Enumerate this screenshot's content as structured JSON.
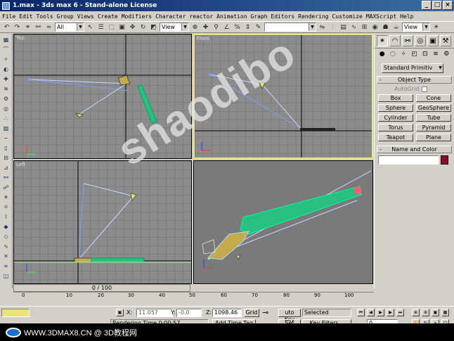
{
  "window": {
    "title": "1.max - 3ds max 6 - Stand-alone License",
    "buttons": [
      "_",
      "□",
      "×"
    ]
  },
  "menu": [
    "File",
    "Edit",
    "Tools",
    "Group",
    "Views",
    "Create",
    "Modifiers",
    "Character",
    "reactor",
    "Animation",
    "Graph Editors",
    "Rendering",
    "Customize",
    "MAXScript",
    "Help"
  ],
  "toolbar": {
    "selection_filter": "All",
    "ref_coord": "View",
    "named_selection": "",
    "view_right": "View"
  },
  "viewports": {
    "top": "Top",
    "front": "Front",
    "left": "Left",
    "perspective": ""
  },
  "command_panel": {
    "category": "Standard Primitiv",
    "object_type_header": "Object Type",
    "autogrid_label": "AutoGrid",
    "buttons": [
      "Box",
      "Cone",
      "Sphere",
      "GeoSphere",
      "Cylinder",
      "Tube",
      "Torus",
      "Pyramid",
      "Teapot",
      "Plane"
    ],
    "name_color_header": "Name and Color",
    "object_color": "#8b0b2a"
  },
  "time": {
    "slider": "0 / 100",
    "ticks": [
      "0",
      "10",
      "20",
      "30",
      "40",
      "50",
      "60",
      "70",
      "80",
      "90",
      "100"
    ]
  },
  "status": {
    "x_label": "X:",
    "x_value": "11.057",
    "y_label": "Y:",
    "y_value": "-0.0",
    "z_label": "Z:",
    "z_value": "1098.46",
    "grid_label": "Grid",
    "auto_key": "uto Key",
    "selected": "Selected",
    "set_key": "Set Key",
    "key_filters": "Key Filters...",
    "rendering_time": "Rendering Time  0:00:57",
    "add_time_tag": "Add Time Tag",
    "frame": "0"
  },
  "watermark": {
    "big": "shaodibo",
    "bar_text": "WWW.3DMAX8.CN @ 3D教程网"
  }
}
